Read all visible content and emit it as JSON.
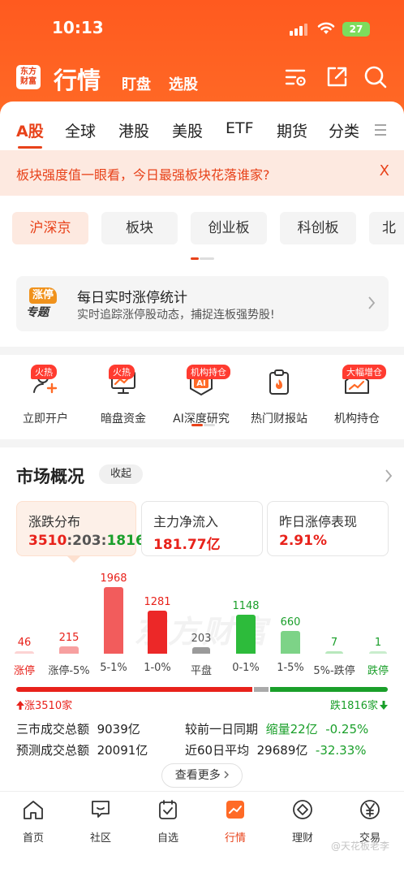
{
  "status_bar": {
    "time": "10:13",
    "battery": "27"
  },
  "nav": {
    "logo": "东方财富",
    "title": "行情",
    "links": [
      "盯盘",
      "选股"
    ]
  },
  "market_tabs": [
    "A股",
    "全球",
    "港股",
    "美股",
    "ETF",
    "期货",
    "分类"
  ],
  "banner": {
    "text": "板块强度值一眼看，今日最强板块花落谁家?",
    "close": "X"
  },
  "chips": [
    "沪深京",
    "板块",
    "创业板",
    "科创板",
    "北交"
  ],
  "promo": {
    "badge_top": "涨停",
    "badge_bottom": "专题",
    "title": "每日实时涨停统计",
    "subtitle": "实时追踪涨停股动态，捕捉连板强势股!"
  },
  "functions": [
    {
      "label": "立即开户",
      "badge": "火热"
    },
    {
      "label": "暗盘资金",
      "badge": "火热"
    },
    {
      "label": "AI深度研究",
      "badge": "机构持仓"
    },
    {
      "label": "热门财报站",
      "badge": ""
    },
    {
      "label": "机构持仓",
      "badge": "大幅增仓"
    }
  ],
  "overview": {
    "title": "市场概况",
    "collapse": "收起",
    "cards": [
      {
        "label": "涨跌分布",
        "up": "3510",
        "flat": "203",
        "down": "1816",
        "sep": ":"
      },
      {
        "label": "主力净流入",
        "value": "181.77亿"
      },
      {
        "label": "昨日涨停表现",
        "value": "2.91%"
      }
    ],
    "watermark": "东方财富"
  },
  "chart_data": {
    "type": "bar",
    "categories": [
      "涨停",
      "涨停-5%",
      "5-1%",
      "1-0%",
      "平盘",
      "0-1%",
      "1-5%",
      "5%-跌停",
      "跌停"
    ],
    "values": [
      46,
      215,
      1968,
      1281,
      203,
      1148,
      660,
      7,
      1
    ],
    "colors": [
      "#fcd3d3",
      "#f7a0a0",
      "#f25c5c",
      "#ec2828",
      "#9a9a9a",
      "#2dbb3b",
      "#7dd387",
      "#b8e8bd",
      "#c9edcd"
    ],
    "label_colors": [
      "#e8221b",
      "#e8221b",
      "#e8221b",
      "#e8221b",
      "#555555",
      "#1a9f2a",
      "#1a9f2a",
      "#1a9f2a",
      "#1a9f2a"
    ],
    "ylim": [
      0,
      1968
    ]
  },
  "ratio": {
    "up_label": "涨3510家",
    "down_label": "跌1816家",
    "up": 3510,
    "flat": 203,
    "down": 1816
  },
  "stats": {
    "row1_label": "三市成交总额",
    "row1_value": "9039亿",
    "row1_compare_label": "较前一日同期",
    "row1_change": "缩量22亿",
    "row1_pct": "-0.25%",
    "row2_label": "预测成交总额",
    "row2_value": "20091亿",
    "row2_compare_label": "近60日平均",
    "row2_avg": "29689亿",
    "row2_pct": "-32.33%"
  },
  "more_button": "查看更多",
  "bottom_tabs": [
    "首页",
    "社区",
    "自选",
    "行情",
    "理财",
    "交易"
  ],
  "watermark_text": "@天花板老李",
  "colors": {
    "brand": "#ff5a1f",
    "accent": "#e8421a",
    "up": "#e8221b",
    "down": "#1a9f2a"
  }
}
